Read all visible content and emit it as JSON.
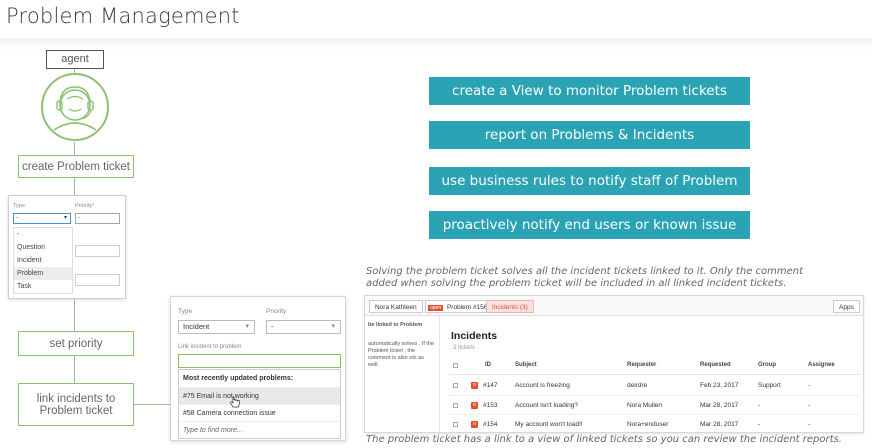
{
  "title": "Problem Management",
  "flow": {
    "agent_label": "agent",
    "step_create": "create Problem ticket",
    "step_priority": "set priority",
    "step_link": "link incidents to Problem ticket"
  },
  "type_dropdown": {
    "type_label": "Type",
    "priority_label": "Priority*",
    "selected": "-",
    "priority_value": "-",
    "options": [
      "-",
      "Question",
      "Incident",
      "Problem",
      "Task"
    ]
  },
  "link_panel": {
    "type_label": "Type",
    "priority_label": "Priority",
    "type_value": "Incident",
    "priority_value": "-",
    "link_label": "Link incident to problem",
    "list_header": "Most recently updated problems:",
    "items": [
      "#75 Email is not working",
      "#58 Camera connection issue"
    ],
    "more": "Type to find more..."
  },
  "actions": [
    "create a View to monitor Problem tickets",
    "report on Problems & Incidents",
    "use business rules to notify staff of Problem",
    "proactively notify end users or known issue"
  ],
  "caption_top": "Solving the problem ticket solves all the incident tickets linked to it. Only the comment added when solving the problem ticket will be included in all linked incident tickets.",
  "caption_bottom": "The problem ticket has a link to a view of linked tickets so you can review the incident reports.",
  "incidents_view": {
    "tab_user": "Nora Kathleen",
    "tab_status": "open",
    "tab_problem": "Problem #156",
    "tab_incidents": "Incidents (3)",
    "apps": "Apps",
    "sidebar_title": "be linked to Problem",
    "sidebar_text": "automatically solves . If the Problem ticket , the comment is also ets as well.",
    "heading": "Incidents",
    "count": "3 tickets",
    "columns": [
      "ID",
      "Subject",
      "Requester",
      "Requested",
      "Group",
      "Assignee"
    ],
    "rows": [
      [
        "#147",
        "Account is freezing",
        "deirdre",
        "Feb 23, 2017",
        "Support",
        "-"
      ],
      [
        "#153",
        "Account isn't loading?",
        "Nora Mullen",
        "Mar 28, 2017",
        "-",
        "-"
      ],
      [
        "#154",
        "My account won't load!!",
        "Nora+enduser",
        "Mar 28, 2017",
        "-",
        "-"
      ]
    ],
    "badge": "o"
  },
  "colors": {
    "action_bg": "#2aa3b5",
    "flow_border": "#8fbf72",
    "badge_red": "#e34f32"
  }
}
